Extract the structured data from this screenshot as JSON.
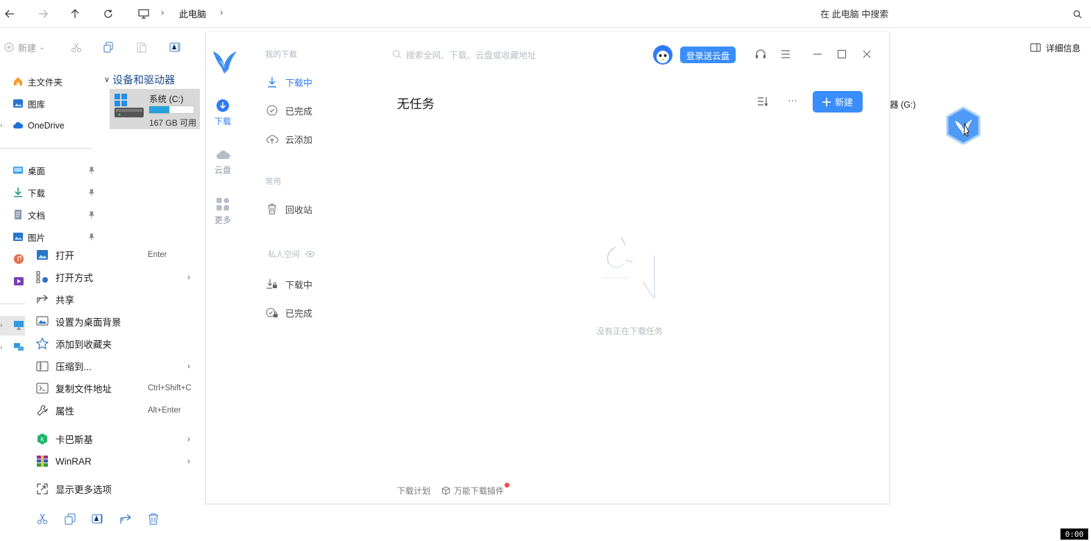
{
  "explorer": {
    "breadcrumb": [
      "此电脑"
    ],
    "search_placeholder": "在 此电脑 中搜索",
    "toolbar": {
      "new_label": "新建",
      "details_label": "详细信息"
    },
    "sidebar": {
      "top_items": [
        "主文件夹",
        "图库",
        "OneDrive"
      ],
      "pinned_items": [
        "桌面",
        "下载",
        "文档",
        "图片"
      ]
    },
    "section_title": "设备和驱动器",
    "drive": {
      "name": "系统 (C:)",
      "free": "167 GB 可用",
      "used_fraction": 0.45
    },
    "right_drive_label": "器 (G:)"
  },
  "context_menu": {
    "items": [
      {
        "label": "打开",
        "shortcut": "Enter",
        "icon": "image-icon",
        "submenu": false
      },
      {
        "label": "打开方式",
        "shortcut": "",
        "icon": "open-with-icon",
        "submenu": true
      },
      {
        "label": "共享",
        "shortcut": "",
        "icon": "share-icon",
        "submenu": false
      },
      {
        "label": "设置为桌面背景",
        "shortcut": "",
        "icon": "wallpaper-icon",
        "submenu": false
      },
      {
        "label": "添加到收藏夹",
        "shortcut": "",
        "icon": "star-icon",
        "submenu": false
      },
      {
        "label": "压缩到...",
        "shortcut": "",
        "icon": "zip-icon",
        "submenu": true
      },
      {
        "label": "复制文件地址",
        "shortcut": "Ctrl+Shift+C",
        "icon": "copy-path-icon",
        "submenu": false
      },
      {
        "label": "属性",
        "shortcut": "Alt+Enter",
        "icon": "wrench-icon",
        "submenu": false
      },
      {
        "label": "卡巴斯基",
        "shortcut": "",
        "icon": "kaspersky-icon",
        "submenu": true
      },
      {
        "label": "WinRAR",
        "shortcut": "",
        "icon": "winrar-icon",
        "submenu": true
      },
      {
        "label": "显示更多选项",
        "shortcut": "",
        "icon": "more-options-icon",
        "submenu": false
      }
    ]
  },
  "xunlei": {
    "search_placeholder": "搜索全网、下载、云盘或收藏地址",
    "login_label": "登录送云盘",
    "rail": [
      "下载",
      "云盘",
      "更多"
    ],
    "groups": {
      "my_downloads": "我的下载",
      "common": "常用",
      "private": "私人空间"
    },
    "nav": {
      "downloading": "下载中",
      "completed": "已完成",
      "cloud_add": "云添加",
      "recycle": "回收站",
      "private_downloading": "下载中",
      "private_completed": "已完成"
    },
    "title": "无任务",
    "new_button": "新建",
    "empty_text": "没有正在下载任务",
    "footer": {
      "plan": "下载计划",
      "plugin": "万能下载插件"
    },
    "accent": "#3a8dfb"
  },
  "clock": "0:00"
}
